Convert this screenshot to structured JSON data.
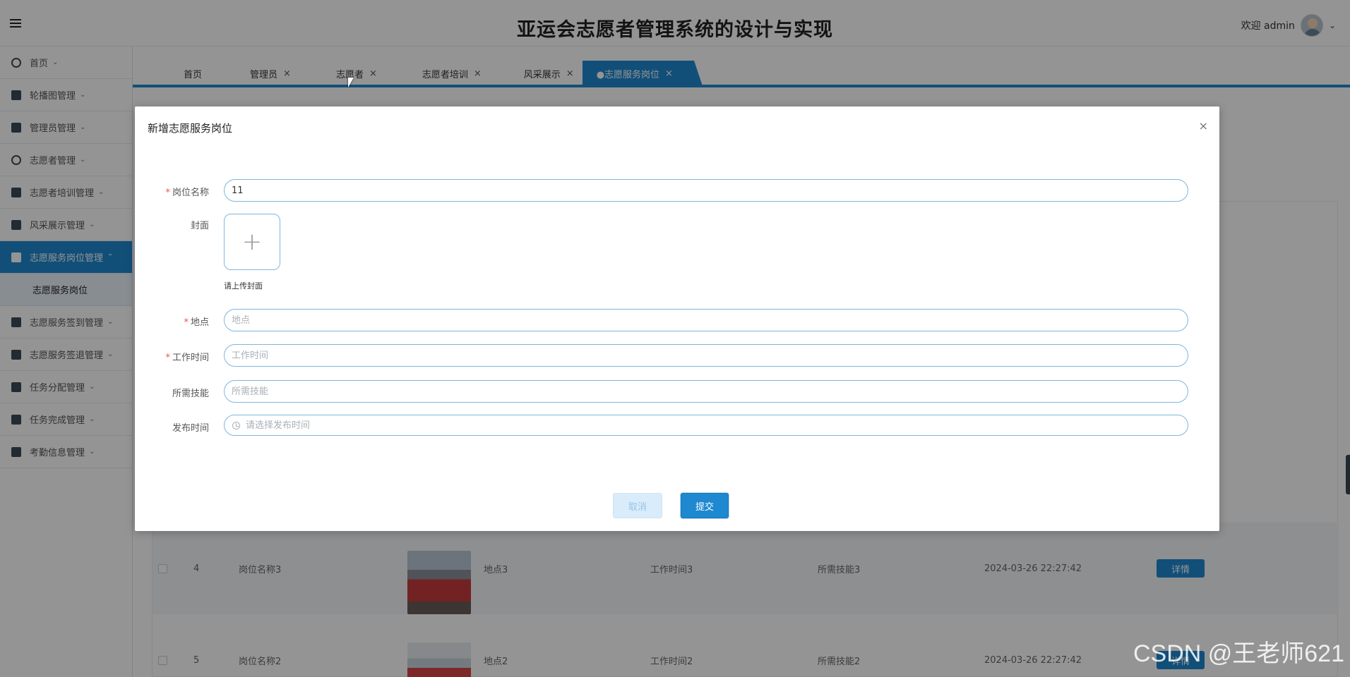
{
  "header": {
    "title": "亚运会志愿者管理系统的设计与实现",
    "welcome": "欢迎 admin"
  },
  "sidebar": {
    "items": [
      {
        "label": "首页",
        "icon": "home-icon"
      },
      {
        "label": "轮播图管理",
        "icon": "carousel-icon"
      },
      {
        "label": "管理员管理",
        "icon": "admin-icon"
      },
      {
        "label": "志愿者管理",
        "icon": "volunteer-icon"
      },
      {
        "label": "志愿者培训管理",
        "icon": "training-icon"
      },
      {
        "label": "风采展示管理",
        "icon": "showcase-icon"
      },
      {
        "label": "志愿服务岗位管理",
        "icon": "post-icon",
        "active": true
      },
      {
        "label": "志愿服务签到管理",
        "icon": "checkin-icon"
      },
      {
        "label": "志愿服务签退管理",
        "icon": "checkout-icon"
      },
      {
        "label": "任务分配管理",
        "icon": "task-assign-icon"
      },
      {
        "label": "任务完成管理",
        "icon": "task-done-icon"
      },
      {
        "label": "考勤信息管理",
        "icon": "attendance-icon"
      }
    ],
    "active_sub": "志愿服务岗位"
  },
  "tabs": [
    {
      "label": "首页",
      "closable": false
    },
    {
      "label": "管理员",
      "closable": true
    },
    {
      "label": "志愿者",
      "closable": true
    },
    {
      "label": "志愿者培训",
      "closable": true
    },
    {
      "label": "风采展示",
      "closable": true
    },
    {
      "label": "●志愿服务岗位",
      "closable": true,
      "active": true
    }
  ],
  "close_glyph": "×",
  "table": {
    "rows": [
      {
        "index": "4",
        "name": "岗位名称3",
        "location": "地点3",
        "time": "工作时间3",
        "skill": "所需技能3",
        "date": "2024-03-26 22:27:42",
        "action": "详情"
      },
      {
        "index": "5",
        "name": "岗位名称2",
        "location": "地点2",
        "time": "工作时间2",
        "skill": "所需技能2",
        "date": "2024-03-26 22:27:42",
        "action": "详情"
      }
    ]
  },
  "modal": {
    "title": "新增志愿服务岗位",
    "close": "×",
    "fields": {
      "name": {
        "label": "岗位名称",
        "value": "11",
        "required": true
      },
      "cover": {
        "label": "封面",
        "plus": "+",
        "tip": "请上传封面"
      },
      "location": {
        "label": "地点",
        "placeholder": "地点",
        "required": true
      },
      "work_time": {
        "label": "工作时间",
        "placeholder": "工作时间",
        "required": true
      },
      "skills": {
        "label": "所需技能",
        "placeholder": "所需技能"
      },
      "publish_time": {
        "label": "发布时间",
        "placeholder": "请选择发布时间"
      }
    },
    "required_mark": "*",
    "cancel": "取消",
    "submit": "提交"
  },
  "watermark": "CSDN @王老师621"
}
